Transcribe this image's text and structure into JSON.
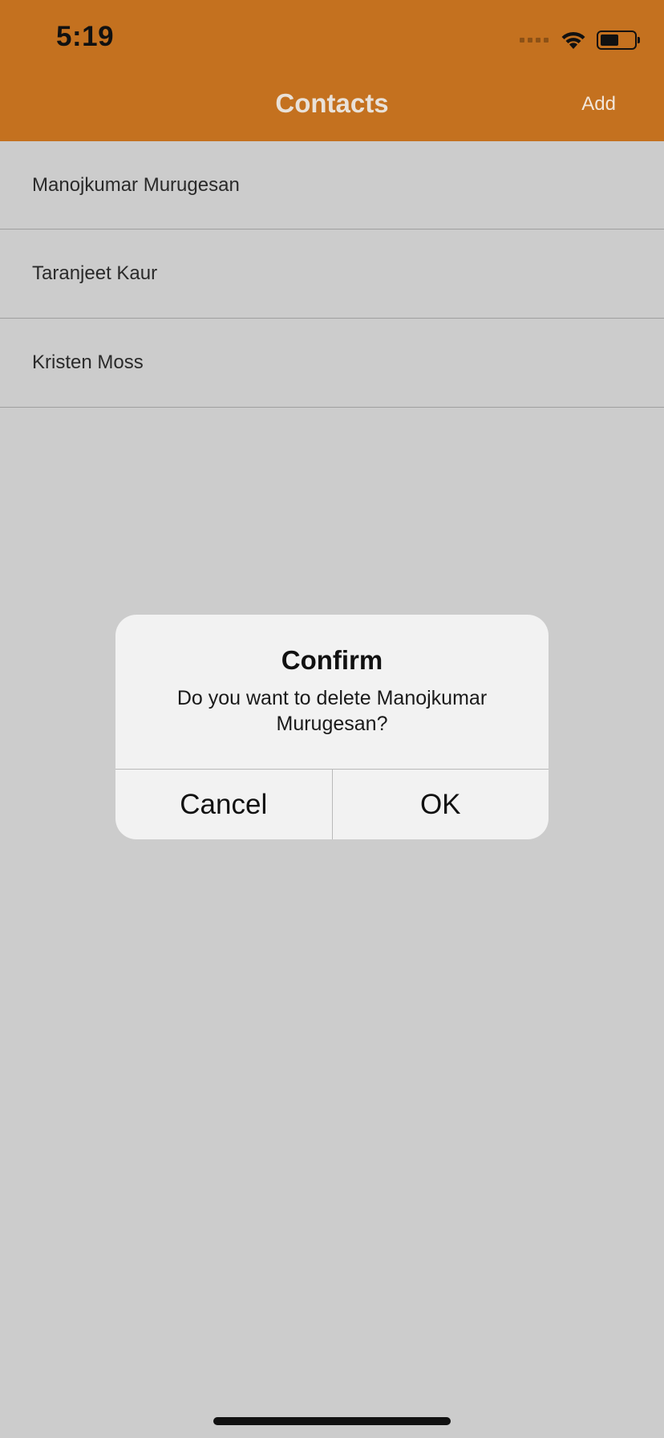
{
  "status_bar": {
    "time": "5:19"
  },
  "nav": {
    "title": "Contacts",
    "add_label": "Add"
  },
  "contacts": [
    {
      "name": "Manojkumar Murugesan"
    },
    {
      "name": "Taranjeet Kaur"
    },
    {
      "name": "Kristen Moss"
    }
  ],
  "alert": {
    "title": "Confirm",
    "message": "Do you want to delete Manojkumar Murugesan?",
    "cancel_label": "Cancel",
    "ok_label": "OK"
  },
  "colors": {
    "header": "#c4711f",
    "background": "#cccccc",
    "alert_background": "#f2f2f2"
  }
}
